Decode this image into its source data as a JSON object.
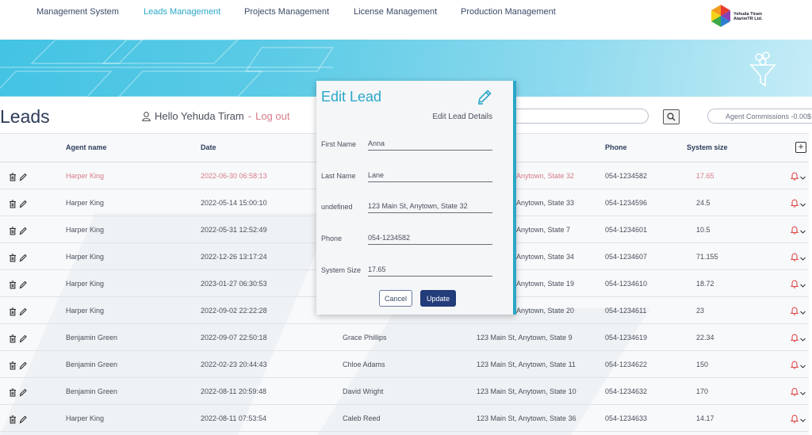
{
  "nav": {
    "items": [
      {
        "label": "Management System",
        "active": false
      },
      {
        "label": "Leads Management",
        "active": true
      },
      {
        "label": "Projects Management",
        "active": false
      },
      {
        "label": "License Management",
        "active": false
      },
      {
        "label": "Production Management",
        "active": false
      }
    ],
    "logo_line1": "Yehuda Tiram",
    "logo_line2": "AtarimTR Ltd."
  },
  "header": {
    "title": "Leads",
    "greeting": "Hello Yehuda Tiram",
    "separator": "-",
    "logout": "Log out",
    "commissions_label": "Agent Commissions -0.00$"
  },
  "table": {
    "columns": {
      "agent": "Agent name",
      "date": "Date",
      "phone": "Phone",
      "system_size": "System size"
    },
    "rows": [
      {
        "agent": "Harper King",
        "date": "2022-06-30 06:58:13",
        "name": "",
        "address": "Anytown, State 32",
        "phone": "054-1234582",
        "size": "17.65",
        "highlight": true
      },
      {
        "agent": "Harper King",
        "date": "2022-05-14 15:00:10",
        "name": "",
        "address": "Anytown, State 33",
        "phone": "054-1234596",
        "size": "24.5",
        "highlight": false
      },
      {
        "agent": "Harper King",
        "date": "2022-05-31 12:52:49",
        "name": "",
        "address": "Anytown, State 7",
        "phone": "054-1234601",
        "size": "10.5",
        "highlight": false
      },
      {
        "agent": "Harper King",
        "date": "2022-12-26 13:17:24",
        "name": "",
        "address": "Anytown, State 34",
        "phone": "054-1234607",
        "size": "71.155",
        "highlight": false
      },
      {
        "agent": "Harper King",
        "date": "2023-01-27 06:30:53",
        "name": "",
        "address": "Anytown, State 19",
        "phone": "054-1234610",
        "size": "18.72",
        "highlight": false
      },
      {
        "agent": "Harper King",
        "date": "2022-09-02 22:22:28",
        "name": "",
        "address": "Anytown, State 20",
        "phone": "054-1234611",
        "size": "23",
        "highlight": false
      },
      {
        "agent": "Benjamin Green",
        "date": "2022-09-07 22:50:18",
        "name": "Grace Phillips",
        "address": "123 Main St, Anytown, State 9",
        "phone": "054-1234619",
        "size": "22.34",
        "highlight": false
      },
      {
        "agent": "Benjamin Green",
        "date": "2022-02-23 20:44:43",
        "name": "Chloe Adams",
        "address": "123 Main St, Anytown, State 11",
        "phone": "054-1234622",
        "size": "150",
        "highlight": false
      },
      {
        "agent": "Benjamin Green",
        "date": "2022-08-11 20:59:48",
        "name": "David Wright",
        "address": "123 Main St, Anytown, State 10",
        "phone": "054-1234632",
        "size": "170",
        "highlight": false
      },
      {
        "agent": "Harper King",
        "date": "2022-08-11 07:53:54",
        "name": "Caleb Reed",
        "address": "123 Main St, Anytown, State 36",
        "phone": "054-1234633",
        "size": "14.17",
        "highlight": false
      }
    ]
  },
  "modal": {
    "title": "Edit Lead",
    "subtitle": "Edit Lead Details",
    "fields": [
      {
        "label": "First Name",
        "value": "Anna"
      },
      {
        "label": "Last Name",
        "value": "Lane"
      },
      {
        "label": "undefined",
        "value": "123 Main St, Anytown, State 32"
      },
      {
        "label": "Phone",
        "value": "054-1234582"
      },
      {
        "label": "System Size",
        "value": "17.65"
      }
    ],
    "cancel_label": "Cancel",
    "update_label": "Update"
  },
  "colors": {
    "accent": "#2aa7c8",
    "highlight_text": "#d87a8a",
    "primary_button": "#233c7a"
  },
  "icons": {
    "delete": "trash-icon",
    "edit": "pencil-icon",
    "notify": "bell-icon",
    "expand": "chevron-down-icon",
    "search": "search-icon",
    "user": "user-icon"
  }
}
